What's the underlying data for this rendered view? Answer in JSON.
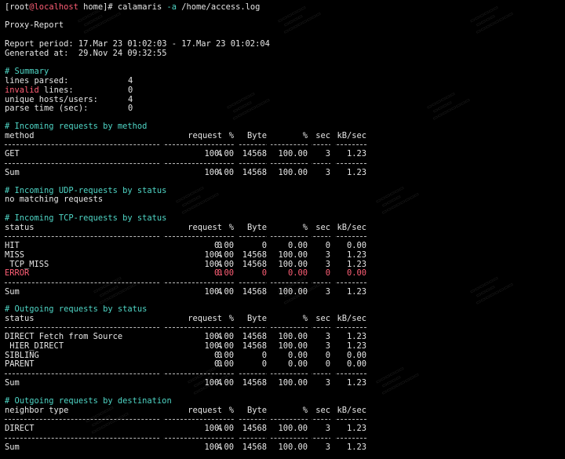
{
  "prompt": {
    "open_bracket": "[",
    "user": "root",
    "at_host": "@localhost",
    "cwd": " home",
    "close_bracket": "]#",
    "command": "calamaris",
    "option": "-a",
    "argument": "/home/access.log"
  },
  "report_title": "Proxy-Report",
  "report_period_label": "Report period:",
  "report_period_value": "17.Mar 23 01:02:03 - 17.Mar 23 01:02:04",
  "generated_label": "Generated at:",
  "generated_value": "29.Nov 24 09:32:55",
  "summary": {
    "heading": "# Summary",
    "lines_parsed_label": "lines parsed:",
    "lines_parsed": "4",
    "invalid_label": "invalid",
    "invalid_suffix": " lines:",
    "invalid_lines": "0",
    "unique_hosts_label": "unique hosts/users:",
    "unique_hosts": "4",
    "parse_time_label": "parse time (sec):",
    "parse_time": "0"
  },
  "columns": {
    "request": "request",
    "percent": "%",
    "byte": "Byte",
    "byte_percent": "%",
    "sec": "sec",
    "kb_sec": "kB/sec"
  },
  "incoming_method": {
    "heading": "# Incoming requests by method",
    "key_header": "method",
    "rows": [
      {
        "name": "GET",
        "request": "4",
        "pct": "100.00",
        "byte": "14568",
        "bpct": "100.00",
        "sec": "3",
        "kbsec": "1.23"
      }
    ],
    "sum": {
      "name": "Sum",
      "request": "4",
      "pct": "100.00",
      "byte": "14568",
      "bpct": "100.00",
      "sec": "3",
      "kbsec": "1.23"
    }
  },
  "incoming_udp": {
    "heading": "# Incoming UDP-requests by status",
    "message": "no matching requests"
  },
  "incoming_tcp": {
    "heading": "# Incoming TCP-requests by status",
    "key_header": "status",
    "rows": [
      {
        "name": "HIT",
        "request": "0",
        "pct": "0.00",
        "byte": "0",
        "bpct": "0.00",
        "sec": "0",
        "kbsec": "0.00"
      },
      {
        "name": "MISS",
        "request": "4",
        "pct": "100.00",
        "byte": "14568",
        "bpct": "100.00",
        "sec": "3",
        "kbsec": "1.23"
      },
      {
        "name": " TCP_MISS",
        "request": "4",
        "pct": "100.00",
        "byte": "14568",
        "bpct": "100.00",
        "sec": "3",
        "kbsec": "1.23"
      },
      {
        "name": "ERROR",
        "request": "0",
        "pct": "0.00",
        "byte": "0",
        "bpct": "0.00",
        "sec": "0",
        "kbsec": "0.00",
        "color": "#ff5f76"
      }
    ],
    "sum": {
      "name": "Sum",
      "request": "4",
      "pct": "100.00",
      "byte": "14568",
      "bpct": "100.00",
      "sec": "3",
      "kbsec": "1.23"
    }
  },
  "outgoing_status": {
    "heading": "# Outgoing requests by status",
    "key_header": "status",
    "rows": [
      {
        "name": "DIRECT Fetch from Source",
        "request": "4",
        "pct": "100.00",
        "byte": "14568",
        "bpct": "100.00",
        "sec": "3",
        "kbsec": "1.23"
      },
      {
        "name": " HIER_DIRECT",
        "request": "4",
        "pct": "100.00",
        "byte": "14568",
        "bpct": "100.00",
        "sec": "3",
        "kbsec": "1.23"
      },
      {
        "name": "SIBLING",
        "request": "0",
        "pct": "0.00",
        "byte": "0",
        "bpct": "0.00",
        "sec": "0",
        "kbsec": "0.00"
      },
      {
        "name": "PARENT",
        "request": "0",
        "pct": "0.00",
        "byte": "0",
        "bpct": "0.00",
        "sec": "0",
        "kbsec": "0.00"
      }
    ],
    "sum": {
      "name": "Sum",
      "request": "4",
      "pct": "100.00",
      "byte": "14568",
      "bpct": "100.00",
      "sec": "3",
      "kbsec": "1.23"
    }
  },
  "outgoing_destination": {
    "heading": "# Outgoing requests by destination",
    "key_header": "neighbor type",
    "rows": [
      {
        "name": "DIRECT",
        "request": "4",
        "pct": "100.00",
        "byte": "14568",
        "bpct": "100.00",
        "sec": "3",
        "kbsec": "1.23"
      }
    ],
    "sum": {
      "name": "Sum",
      "request": "4",
      "pct": "100.00",
      "byte": "14568",
      "bpct": "100.00",
      "sec": "3",
      "kbsec": "1.23"
    }
  },
  "colors": {
    "background": "#000000",
    "text": "#e6e6e6",
    "comment": "#4fd6c6",
    "error": "#ff5f76"
  }
}
